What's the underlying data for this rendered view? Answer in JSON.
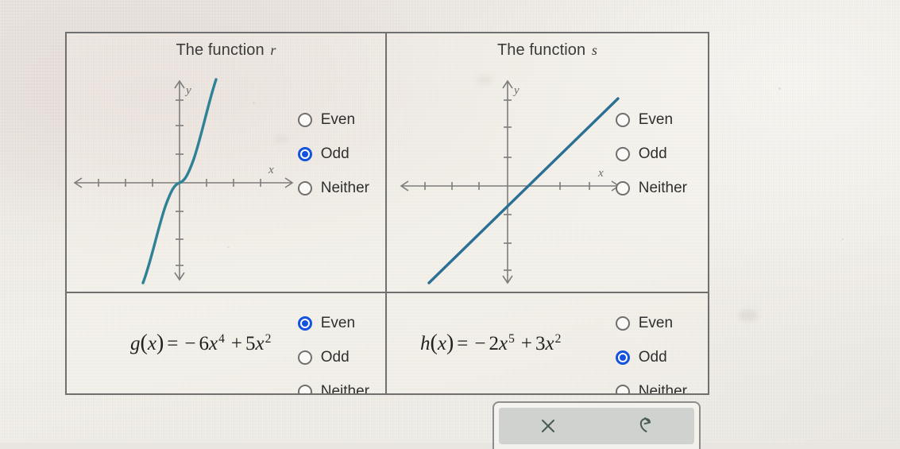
{
  "background": {
    "paper_color": "#edeae3",
    "table_border_color": "#707070"
  },
  "colors": {
    "curve": "#2f8196",
    "line": "#2b6f94",
    "axis": "#7d7d7d",
    "radio_selected": "#1452e0",
    "radio_unselected": "#6f6f6f",
    "text": "#2f2f2f",
    "toolbar_face": "#cfd2cf",
    "toolbar_icon": "#4a5c52"
  },
  "table": {
    "rows": [
      {
        "id": "graph-row",
        "cells": [
          {
            "id": "function-r",
            "title_prefix": "The function",
            "title_var": "r",
            "graph": "cubic-odd",
            "options": [
              {
                "label": "Even",
                "selected": false
              },
              {
                "label": "Odd",
                "selected": true
              },
              {
                "label": "Neither",
                "selected": false
              }
            ]
          },
          {
            "id": "function-s",
            "title_prefix": "The function",
            "title_var": "s",
            "graph": "linear-offset",
            "options": [
              {
                "label": "Even",
                "selected": false
              },
              {
                "label": "Odd",
                "selected": false
              },
              {
                "label": "Neither",
                "selected": false
              }
            ]
          }
        ]
      },
      {
        "id": "equation-row",
        "cells": [
          {
            "id": "function-g",
            "equation": {
              "name": "g",
              "arg": "x",
              "equals": "=",
              "terms": [
                {
                  "sign": "−",
                  "coefficient": "6",
                  "variable": "x",
                  "exponent": "4"
                },
                {
                  "sign": "+",
                  "coefficient": "5",
                  "variable": "x",
                  "exponent": "2"
                }
              ],
              "plain": "g(x) = −6x⁴ + 5x²"
            },
            "options": [
              {
                "label": "Even",
                "selected": true
              },
              {
                "label": "Odd",
                "selected": false
              },
              {
                "label": "Neither",
                "selected": false
              }
            ]
          },
          {
            "id": "function-h",
            "equation": {
              "name": "h",
              "arg": "x",
              "equals": "=",
              "terms": [
                {
                  "sign": "−",
                  "coefficient": "2",
                  "variable": "x",
                  "exponent": "5"
                },
                {
                  "sign": "+",
                  "coefficient": "3",
                  "variable": "x",
                  "exponent": "2"
                }
              ],
              "plain": "h(x) = −2x⁵ + 3x²"
            },
            "options": [
              {
                "label": "Even",
                "selected": false
              },
              {
                "label": "Odd",
                "selected": true
              },
              {
                "label": "Neither",
                "selected": false
              }
            ]
          }
        ]
      }
    ]
  },
  "graphs": {
    "axis_labels": {
      "x": "x",
      "y": "y"
    },
    "function_r": {
      "description": "odd cubic-like curve through the origin, rising left to right",
      "x_ticks": 8,
      "y_ticks": 6
    },
    "function_s": {
      "description": "straight line with positive slope and negative y-intercept",
      "x_ticks": 7,
      "y_ticks": 6
    }
  },
  "toolbar": {
    "buttons": [
      {
        "id": "clear",
        "icon": "close-icon",
        "label": "×"
      },
      {
        "id": "undo",
        "icon": "undo-arrow-icon",
        "label": "↺"
      }
    ]
  }
}
